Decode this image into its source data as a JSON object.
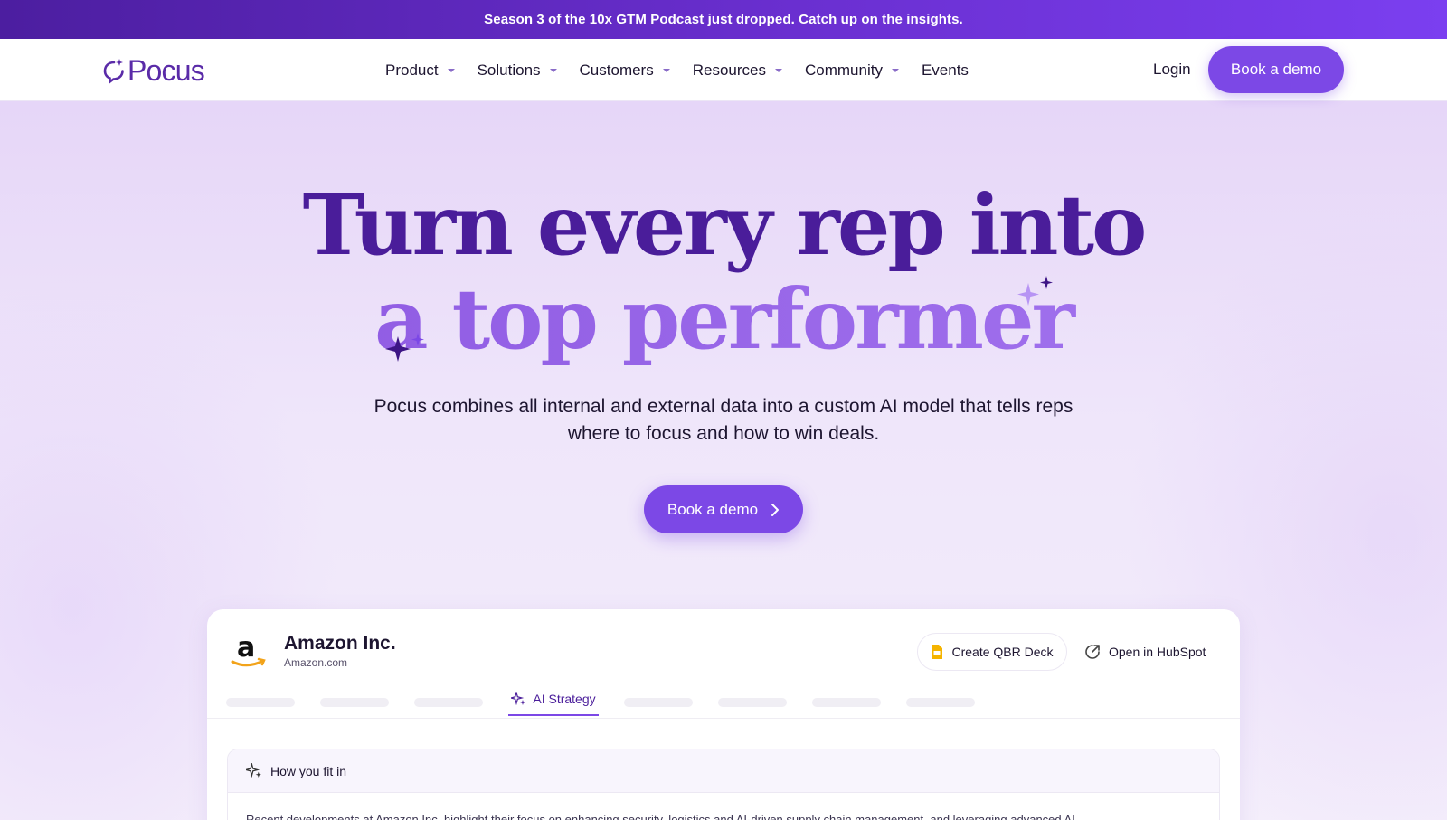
{
  "announcement": {
    "text": "Season 3 of the 10x GTM Podcast just dropped. Catch up on the insights."
  },
  "nav": {
    "brand": "Pocus",
    "items": [
      {
        "label": "Product",
        "has_dropdown": true
      },
      {
        "label": "Solutions",
        "has_dropdown": true
      },
      {
        "label": "Customers",
        "has_dropdown": true
      },
      {
        "label": "Resources",
        "has_dropdown": true
      },
      {
        "label": "Community",
        "has_dropdown": true
      },
      {
        "label": "Events",
        "has_dropdown": false
      }
    ],
    "login_label": "Login",
    "cta_label": "Book a demo"
  },
  "hero": {
    "headline_line1": "Turn every rep into",
    "headline_line2": "a top performer",
    "subtitle": "Pocus combines all internal and external data into a custom AI model that tells reps where to focus and how to win deals.",
    "cta_label": "Book a demo"
  },
  "preview_card": {
    "company_name": "Amazon Inc.",
    "company_domain": "Amazon.com",
    "qbr_button_label": "Create QBR Deck",
    "hubspot_button_label": "Open in HubSpot",
    "active_tab_label": "AI Strategy",
    "section_title": "How you fit in",
    "section_text": "Recent developments at Amazon Inc. highlight their focus on enhancing security, logistics and AI-driven supply chain management, and leveraging advanced AI"
  },
  "colors": {
    "brand_purple": "#7c48e6",
    "deep_purple": "#4a1d9a",
    "announcement_bg": "#5a27b8"
  }
}
